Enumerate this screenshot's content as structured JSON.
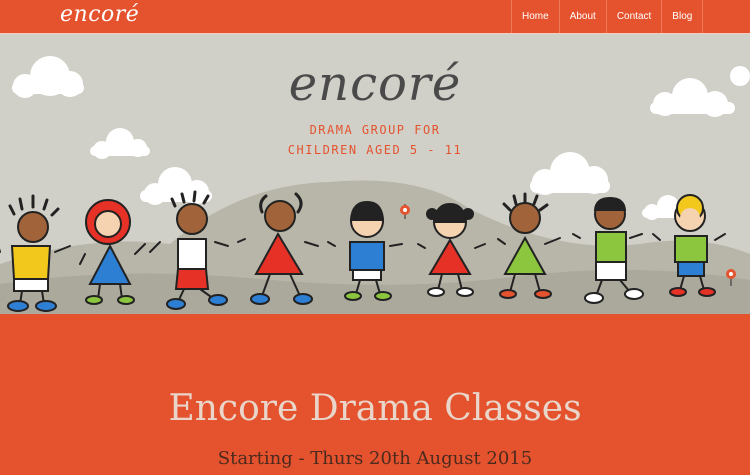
{
  "navbar": {
    "brand": "encoré",
    "items": [
      {
        "label": "Home"
      },
      {
        "label": "About"
      },
      {
        "label": "Contact"
      },
      {
        "label": "Blog"
      }
    ]
  },
  "hero": {
    "logo": "encoré",
    "tagline_line1": "DRAMA GROUP FOR",
    "tagline_line2": "CHILDREN AGED 5 - 11"
  },
  "main": {
    "title": "Encore Drama Classes",
    "subtitle": "Starting - Thurs 20th August 2015"
  },
  "colors": {
    "accent": "#e4532e",
    "hero_background": "#d1d0c8",
    "hills": "#b8b5a9",
    "title_text": "#e9d5c9",
    "subtitle_text": "#4c2a1e"
  }
}
